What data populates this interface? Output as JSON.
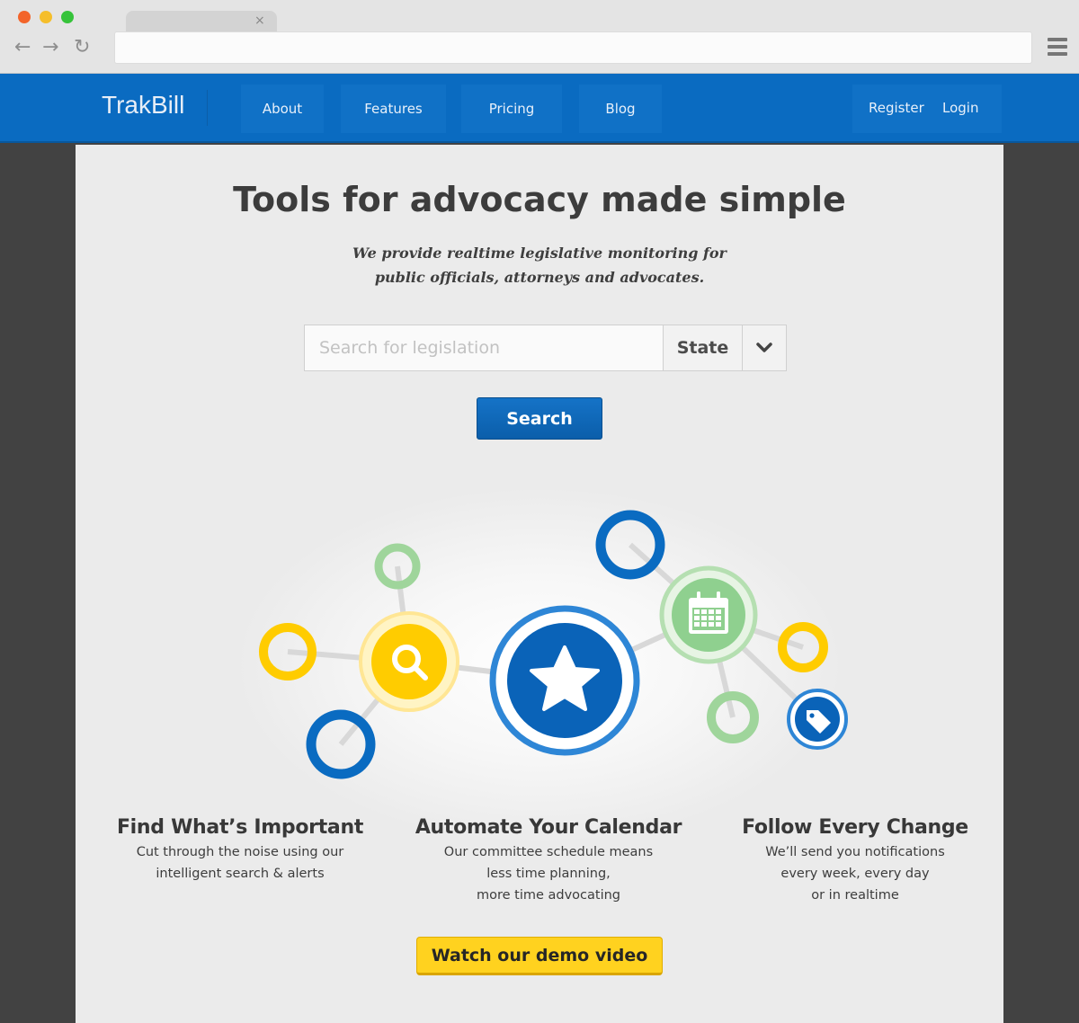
{
  "browser": {
    "tab_close": "×",
    "back": "←",
    "forward": "→",
    "reload": "↻"
  },
  "nav": {
    "logo": "TrakBill",
    "items": [
      {
        "label": "About"
      },
      {
        "label": "Features"
      },
      {
        "label": "Pricing"
      },
      {
        "label": "Blog"
      }
    ],
    "register": "Register",
    "login": "Login"
  },
  "hero": {
    "title": "Tools for advocacy made simple",
    "subtitle_line1": "We provide realtime legislative monitoring for",
    "subtitle_line2": "public officials, attorneys and advocates."
  },
  "search": {
    "placeholder": "Search for legislation",
    "state_label": "State",
    "button": "Search"
  },
  "features": [
    {
      "title": "Find What’s Important",
      "text": "Cut through the noise using our\nintelligent search & alerts"
    },
    {
      "title": "Automate Your Calendar",
      "text": "Our committee schedule means\nless time planning,\nmore time advocating"
    },
    {
      "title": "Follow Every Change",
      "text": "We’ll send you notifications\nevery week, every day\nor in realtime"
    }
  ],
  "cta": {
    "label": "Watch our demo video"
  },
  "colors": {
    "brand_blue": "#0a6bc1",
    "accent_yellow": "#ffcc00",
    "accent_green": "#8fd08f"
  },
  "icons": [
    "search-icon",
    "star-icon",
    "calendar-icon",
    "tag-icon",
    "chevron-down-icon",
    "menu-icon"
  ]
}
